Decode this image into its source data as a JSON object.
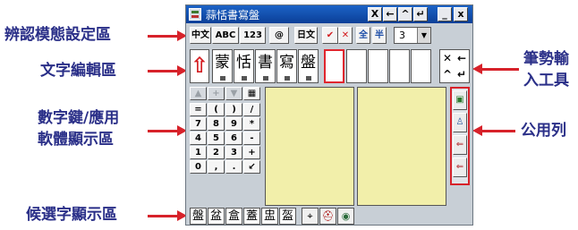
{
  "callouts": {
    "mode_settings": "辨認模態設定區",
    "text_editing": "文字編輯區",
    "numeric_keys": "數字鍵/應用",
    "numeric_keys_2": "軟體顯示區",
    "candidates": "候選字顯示區",
    "stroke_input_1": "筆勢輸",
    "stroke_input_2": "入工具",
    "common_column": "公用列"
  },
  "colors": {
    "label_text": "#2a2f88",
    "arrow": "#d7222a",
    "pad": "#f2efaa",
    "titlebar": "#0b3f98"
  },
  "window": {
    "title": "蒜恬書寫盤",
    "title_buttons": [
      "X",
      "←",
      "^",
      "↵",
      "_",
      "x"
    ]
  },
  "modes": {
    "buttons": [
      "中文",
      "ABC",
      "123",
      "@",
      "日文"
    ],
    "check": "✔",
    "cross": "✕",
    "full_width": "全",
    "half_width": "半",
    "selected_number": "3",
    "dropdown_icon": "chevron-down-icon"
  },
  "edit_row": {
    "shift_icon": "up-arrow-icon",
    "shift_glyph": "⇧",
    "characters": [
      "蒙",
      "恬",
      "書",
      "寫",
      "盤"
    ],
    "blank_count": 5,
    "controls": [
      "✕",
      "←",
      "^",
      "↵"
    ]
  },
  "keypad": {
    "top": [
      "▲",
      "+",
      "▼",
      "▦"
    ],
    "rows": [
      [
        "=",
        "(",
        ")",
        "/"
      ],
      [
        "7",
        "8",
        "9",
        "*"
      ],
      [
        "4",
        "5",
        "6",
        "-"
      ],
      [
        "1",
        "2",
        "3",
        "+"
      ],
      [
        "0",
        ",",
        ".",
        "↙"
      ]
    ]
  },
  "common": {
    "buttons": [
      "▣",
      "♙",
      "⇐",
      "⇐"
    ],
    "icons": [
      "panel-icon",
      "user-icon",
      "back-icon",
      "erase-icon"
    ]
  },
  "candidates": {
    "chars": [
      "盤",
      "盆",
      "盒",
      "蓋",
      "盅",
      "盔"
    ],
    "tools": [
      "⌖",
      "⛑",
      "◉"
    ],
    "tool_icons": [
      "pen-icon",
      "helmet-icon",
      "globe-icon"
    ]
  }
}
